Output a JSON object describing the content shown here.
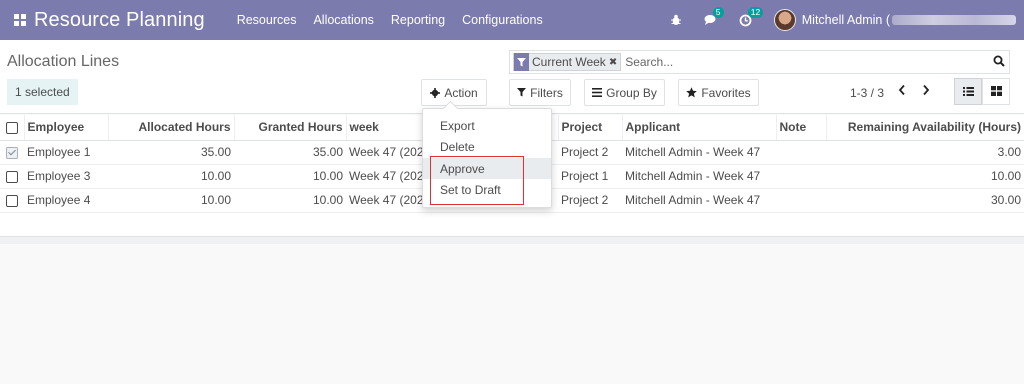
{
  "navbar": {
    "app_title": "Resource Planning",
    "menu": [
      "Resources",
      "Allocations",
      "Reporting",
      "Configurations"
    ],
    "messages_count": "5",
    "activities_count": "12",
    "user_name": "Mitchell Admin (",
    "colors": {
      "navbar_bg": "#7c7bad",
      "badge": "#00a09d"
    }
  },
  "control": {
    "title": "Allocation Lines",
    "selected_label": "1 selected",
    "action_label": "Action",
    "filters_label": "Filters",
    "group_by_label": "Group By",
    "favorites_label": "Favorites",
    "search_facet": "Current Week",
    "search_placeholder": "Search...",
    "pager": "1-3 / 3",
    "view_active": "list"
  },
  "table": {
    "headers": {
      "employee": "Employee",
      "allocated": "Allocated Hours",
      "granted": "Granted Hours",
      "week": "week",
      "project": "Project",
      "applicant": "Applicant",
      "note": "Note",
      "remaining": "Remaining Availability (Hours)"
    },
    "rows": [
      {
        "selected": true,
        "employee": "Employee 1",
        "allocated": "35.00",
        "granted": "35.00",
        "week": "Week 47 (2021",
        "project": "Project 2",
        "applicant": "Mitchell Admin - Week 47",
        "note": "",
        "remaining": "3.00"
      },
      {
        "selected": false,
        "employee": "Employee 3",
        "allocated": "10.00",
        "granted": "10.00",
        "week": "Week 47 (2021",
        "project": "Project 1",
        "applicant": "Mitchell Admin - Week 47",
        "note": "",
        "remaining": "10.00"
      },
      {
        "selected": false,
        "employee": "Employee 4",
        "allocated": "10.00",
        "granted": "10.00",
        "week": "Week 47 (2021",
        "project": "Project 2",
        "applicant": "Mitchell Admin - Week 47",
        "note": "",
        "remaining": "30.00"
      }
    ]
  },
  "action_menu": {
    "items": [
      "Export",
      "Delete",
      "Approve",
      "Set to Draft"
    ],
    "hovered": "Approve",
    "highlight_color": "#e03030"
  },
  "icons": [
    "apps-grid-icon",
    "bug-icon",
    "chat-icon",
    "clock-icon",
    "gear-icon",
    "filter-icon",
    "bars-icon",
    "star-icon",
    "search-icon",
    "chevron-left-icon",
    "chevron-right-icon",
    "list-view-icon",
    "kanban-view-icon"
  ]
}
